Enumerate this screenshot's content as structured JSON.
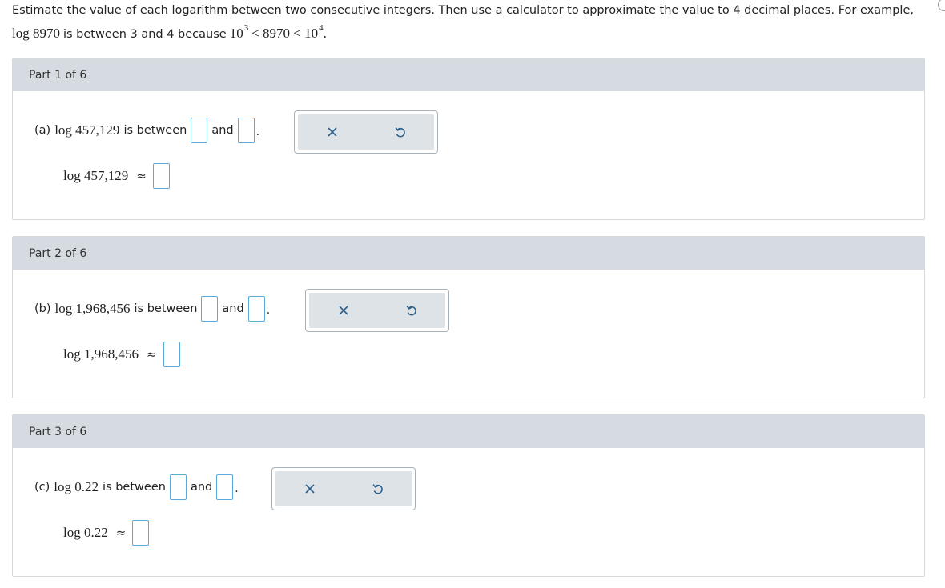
{
  "instructions": {
    "line1": "Estimate the value of each logarithm between two consecutive integers. Then use a calculator to approximate the value to 4 decimal places. For example,",
    "example_log": "log 8970",
    "example_text1": "is between 3 and 4 because",
    "example_math_a": "10",
    "example_exp_a": "3",
    "example_math_b": "< 8970 < 10",
    "example_exp_b": "4",
    "example_end": "."
  },
  "parts": [
    {
      "header": "Part 1 of 6",
      "label": "(a)",
      "expr": "log 457,129",
      "between_text": "is between",
      "and_text": "and",
      "approx_expr": "log 457,129",
      "approx_symbol": "≈"
    },
    {
      "header": "Part 2 of 6",
      "label": "(b)",
      "expr": "log 1,968,456",
      "between_text": "is between",
      "and_text": "and",
      "approx_expr": "log 1,968,456",
      "approx_symbol": "≈"
    },
    {
      "header": "Part 3 of 6",
      "label": "(c)",
      "expr": "log 0.22",
      "between_text": "is between",
      "and_text": "and",
      "approx_expr": "log 0.22",
      "approx_symbol": "≈"
    }
  ],
  "toolbar": {
    "clear_icon": "close-icon",
    "undo_icon": "undo-icon",
    "icon_color": "#2b5f8a"
  }
}
